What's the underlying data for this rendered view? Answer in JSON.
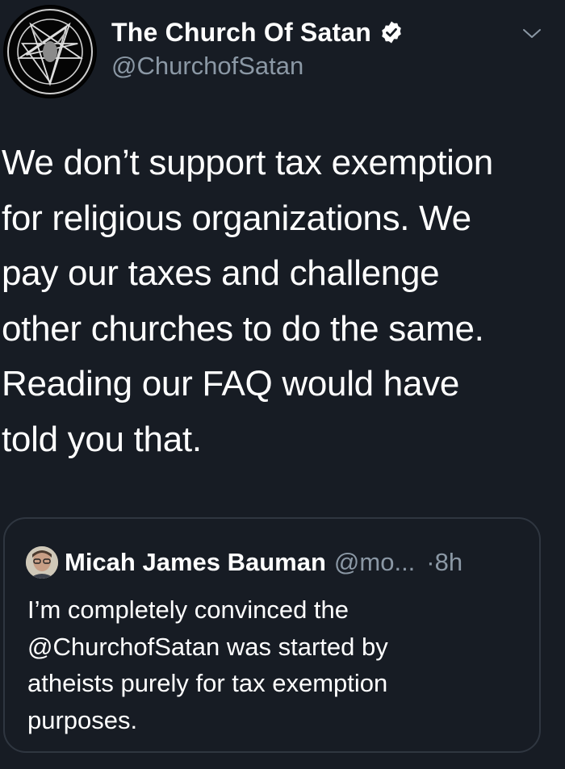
{
  "author": {
    "display_name": "The Church Of Satan",
    "handle": "@ChurchofSatan",
    "avatar_icon": "sigil-of-baphomet-icon",
    "verified_icon": "verified-badge-icon"
  },
  "tweet": {
    "text_lines": [
      "We don’t support tax exemption",
      "for religious organizations. We",
      "pay our taxes and challenge",
      "other churches to do the same.",
      "Reading our FAQ would have",
      "told you that."
    ]
  },
  "quoted_tweet": {
    "display_name": "Micah James Bauman",
    "handle": "@mo...",
    "time": "·8h",
    "text_lines": [
      "I’m completely convinced the",
      "@ChurchofSatan was started by",
      "atheists purely for tax exemption",
      "purposes."
    ]
  },
  "colors": {
    "background": "#171c24",
    "text_primary": "#ffffff",
    "text_secondary": "#8b98a5",
    "border": "#2f3640"
  }
}
